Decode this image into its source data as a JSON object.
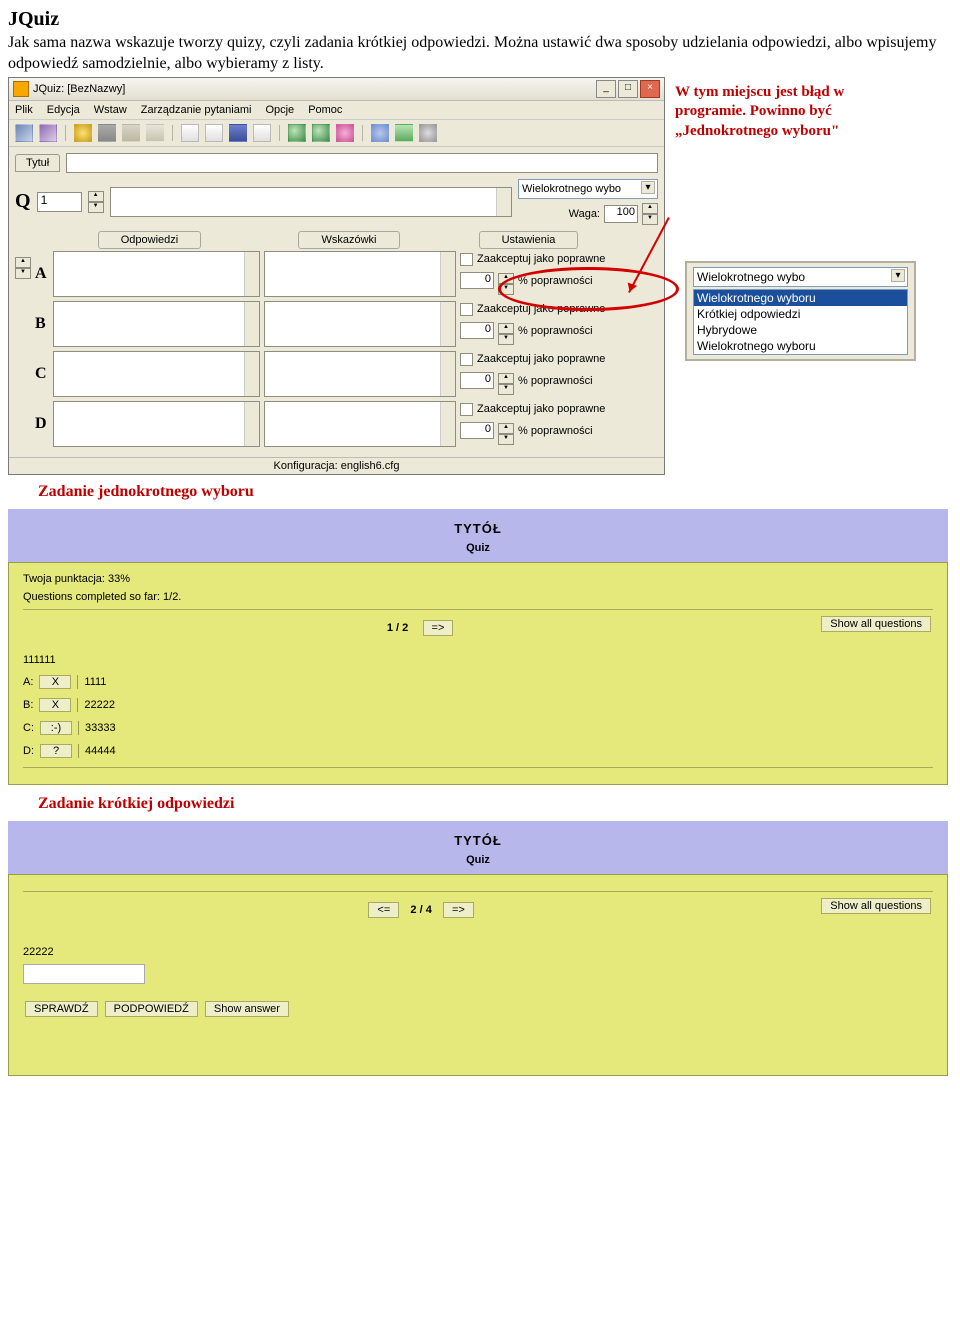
{
  "heading": "JQuiz",
  "intro1": "Jak sama nazwa wskazuje tworzy quizy, czyli zadania krótkiej odpowiedzi. Można ustawić dwa sposoby udzielania odpowiedzi, albo wpisujemy odpowiedź samodzielnie, albo wybieramy z listy.",
  "callout": "W tym miejscu jest błąd w programie. Powinno być „Jednokrotnego wyboru\"",
  "app": {
    "title": "JQuiz: [BezNazwy]",
    "menu": [
      "Plik",
      "Edycja",
      "Wstaw",
      "Zarządzanie pytaniami",
      "Opcje",
      "Pomoc"
    ],
    "title_tab": "Tytuł",
    "q_letter": "Q",
    "q_num": "1",
    "dropdown": "Wielokrotnego wybo",
    "weight_label": "Waga:",
    "weight_val": "100",
    "cols": {
      "odp": "Odpowiedzi",
      "wsk": "Wskazówki",
      "ust": "Ustawienia"
    },
    "accept": "Zaakceptuj jako poprawne",
    "pc_label": "% poprawności",
    "pc_val": "0",
    "rows": [
      "A",
      "B",
      "C",
      "D"
    ],
    "status": "Konfiguracja: english6.cfg"
  },
  "dd": {
    "top": "Wielokrotnego wybo",
    "items": [
      "Wielokrotnego wyboru",
      "Krótkiej odpowiedzi",
      "Hybrydowe",
      "Wielokrotnego wyboru"
    ],
    "selected": 0
  },
  "label1": "Zadanie jednokrotnego wyboru",
  "preview1": {
    "title": "TYTÓŁ",
    "subtitle": "Quiz",
    "score1": "Twoja punktacja: 33%",
    "score2": "Questions completed so far: 1/2.",
    "showall": "Show all questions",
    "nav": "1 / 2",
    "nav_next": "=>",
    "qtext": "111111",
    "opts": [
      {
        "l": "A:",
        "b": "X",
        "t": "1111"
      },
      {
        "l": "B:",
        "b": "X",
        "t": "22222"
      },
      {
        "l": "C:",
        "b": ":-)",
        "t": "33333"
      },
      {
        "l": "D:",
        "b": "?",
        "t": "44444"
      }
    ]
  },
  "label2": "Zadanie krótkiej odpowiedzi",
  "preview2": {
    "title": "TYTÓŁ",
    "subtitle": "Quiz",
    "showall": "Show all questions",
    "nav": "2 / 4",
    "nav_prev": "<=",
    "nav_next": "=>",
    "qtext": "22222",
    "buttons": [
      "SPRAWDŹ",
      "PODPOWIEDŹ",
      "Show answer"
    ]
  }
}
